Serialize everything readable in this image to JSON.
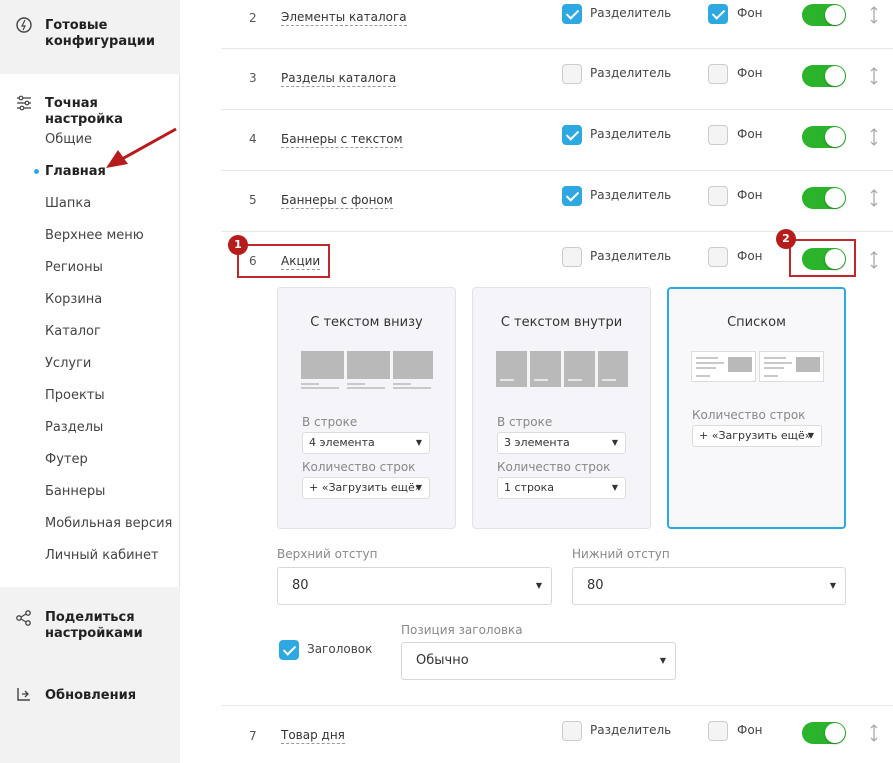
{
  "sidebar": {
    "ready_configs": "Готовые конфигурации",
    "fine_tuning": "Точная настройка",
    "items": [
      {
        "label": "Общие"
      },
      {
        "label": "Главная"
      },
      {
        "label": "Шапка"
      },
      {
        "label": "Верхнее меню"
      },
      {
        "label": "Регионы"
      },
      {
        "label": "Корзина"
      },
      {
        "label": "Каталог"
      },
      {
        "label": "Услуги"
      },
      {
        "label": "Проекты"
      },
      {
        "label": "Разделы"
      },
      {
        "label": "Футер"
      },
      {
        "label": "Баннеры"
      },
      {
        "label": "Мобильная версия"
      },
      {
        "label": "Личный кабинет"
      }
    ],
    "active_item": "Главная",
    "share": "Поделиться настройками",
    "updates": "Обновления"
  },
  "labels": {
    "divider": "Разделитель",
    "background": "Фон"
  },
  "rows": [
    {
      "num": "2",
      "name": "Элементы каталога",
      "divider": true,
      "background": true,
      "enabled": true
    },
    {
      "num": "3",
      "name": "Разделы каталога",
      "divider": false,
      "background": false,
      "enabled": true
    },
    {
      "num": "4",
      "name": "Баннеры с текстом",
      "divider": true,
      "background": false,
      "enabled": true
    },
    {
      "num": "5",
      "name": "Баннеры с фоном",
      "divider": true,
      "background": false,
      "enabled": true
    },
    {
      "num": "6",
      "name": "Акции",
      "divider": false,
      "background": false,
      "enabled": true
    },
    {
      "num": "7",
      "name": "Товар дня",
      "divider": false,
      "background": false,
      "enabled": true
    }
  ],
  "expanded": {
    "cards": [
      {
        "title": "С текстом внизу",
        "in_row_label": "В строке",
        "in_row_value": "4 элемента",
        "rows_label": "Количество строк",
        "rows_value": "+ «Загрузить ещё»"
      },
      {
        "title": "С текстом внутри",
        "in_row_label": "В строке",
        "in_row_value": "3 элемента",
        "rows_label": "Количество строк",
        "rows_value": "1 строка"
      },
      {
        "title": "Списком",
        "rows_label": "Количество строк",
        "rows_value": "+ «Загрузить ещё»",
        "selected": true
      }
    ],
    "top_padding_label": "Верхний отступ",
    "top_padding_value": "80",
    "bottom_padding_label": "Нижний отступ",
    "bottom_padding_value": "80",
    "heading_label": "Заголовок",
    "heading_checked": true,
    "heading_pos_label": "Позиция заголовка",
    "heading_pos_value": "Обычно"
  },
  "annotations": {
    "badge1": "1",
    "badge2": "2"
  },
  "colors": {
    "accent": "#2ea8e0",
    "toggle_on": "#2bb32b",
    "annotation_red": "#c0282b"
  }
}
